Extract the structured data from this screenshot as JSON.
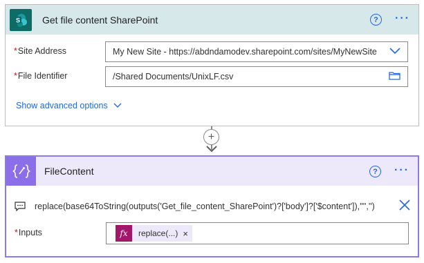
{
  "card1": {
    "title": "Get file content SharePoint",
    "help_glyph": "?",
    "more_glyph": "···",
    "fields": [
      {
        "required": "*",
        "label": "Site Address",
        "value": "My New Site - https://abdndamodev.sharepoint.com/sites/MyNewSite",
        "icon": "chevron-down-icon"
      },
      {
        "required": "*",
        "label": "File Identifier",
        "value": "/Shared Documents/UnixLF.csv",
        "icon": "folder-icon"
      }
    ],
    "advanced_label": "Show advanced options"
  },
  "connector": {
    "plus_glyph": "+"
  },
  "card2": {
    "title": "FileContent",
    "help_glyph": "?",
    "more_glyph": "···",
    "expression": "replace(base64ToString(outputs('Get_file_content_SharePoint')?['body']?['$content']),'\"','')",
    "inputs_required": "*",
    "inputs_label": "Inputs",
    "token_fx": "fx",
    "token_label": "replace(...)",
    "token_remove": "×"
  },
  "colors": {
    "sharepoint_header": "#d7e8ea",
    "sharepoint_icon": "#0f6b66",
    "compose_header": "#ede9fb",
    "compose_icon": "#8b6fe8",
    "accent": "#2266e3",
    "expression_token": "#a3176a"
  }
}
